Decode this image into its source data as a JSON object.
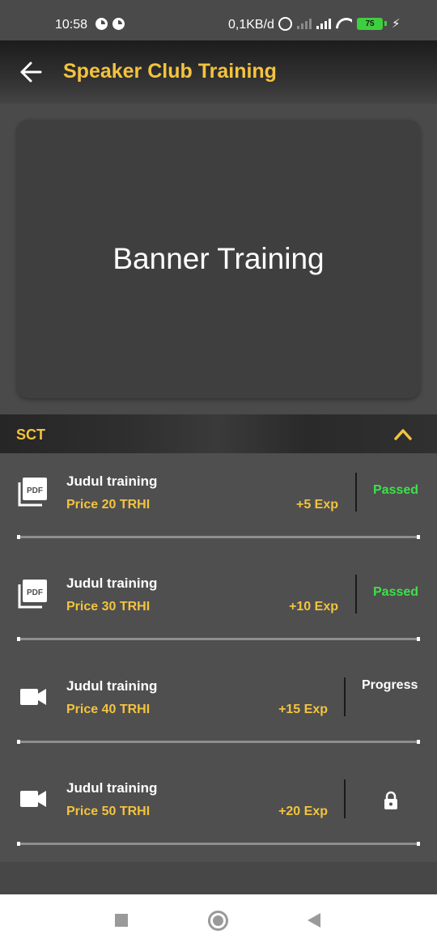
{
  "status_bar": {
    "time": "10:58",
    "network_speed": "0,1KB/d",
    "battery_level": "75",
    "icons": [
      "notification-icon",
      "notification-icon",
      "alarm-icon",
      "signal-icon",
      "signal-icon",
      "wifi-icon",
      "battery-icon",
      "charging-icon"
    ]
  },
  "app_bar": {
    "title": "Speaker Club Training",
    "back_icon": "arrow-left-icon"
  },
  "banner": {
    "text": "Banner Training"
  },
  "section": {
    "title": "SCT",
    "expanded": true,
    "toggle_icon": "chevron-up-icon"
  },
  "trainings": [
    {
      "icon": "pdf-icon",
      "title": "Judul training",
      "price": "Price 20 TRHI",
      "exp": "+5 Exp",
      "status": "Passed"
    },
    {
      "icon": "pdf-icon",
      "title": "Judul training",
      "price": "Price 30 TRHI",
      "exp": "+10 Exp",
      "status": "Passed"
    },
    {
      "icon": "video-camera-icon",
      "title": "Judul training",
      "price": "Price 40 TRHI",
      "exp": "+15 Exp",
      "status": "Progress"
    },
    {
      "icon": "video-camera-icon",
      "title": "Judul training",
      "price": "Price 50 TRHI",
      "exp": "+20 Exp",
      "status": "",
      "status_icon": "lock-icon"
    }
  ],
  "colors": {
    "accent": "#f3c33f",
    "passed": "#3ee04a",
    "background": "#4a4a4a"
  },
  "nav_bar": {
    "icons": [
      "recents-square-icon",
      "home-circle-icon",
      "back-triangle-icon"
    ]
  }
}
